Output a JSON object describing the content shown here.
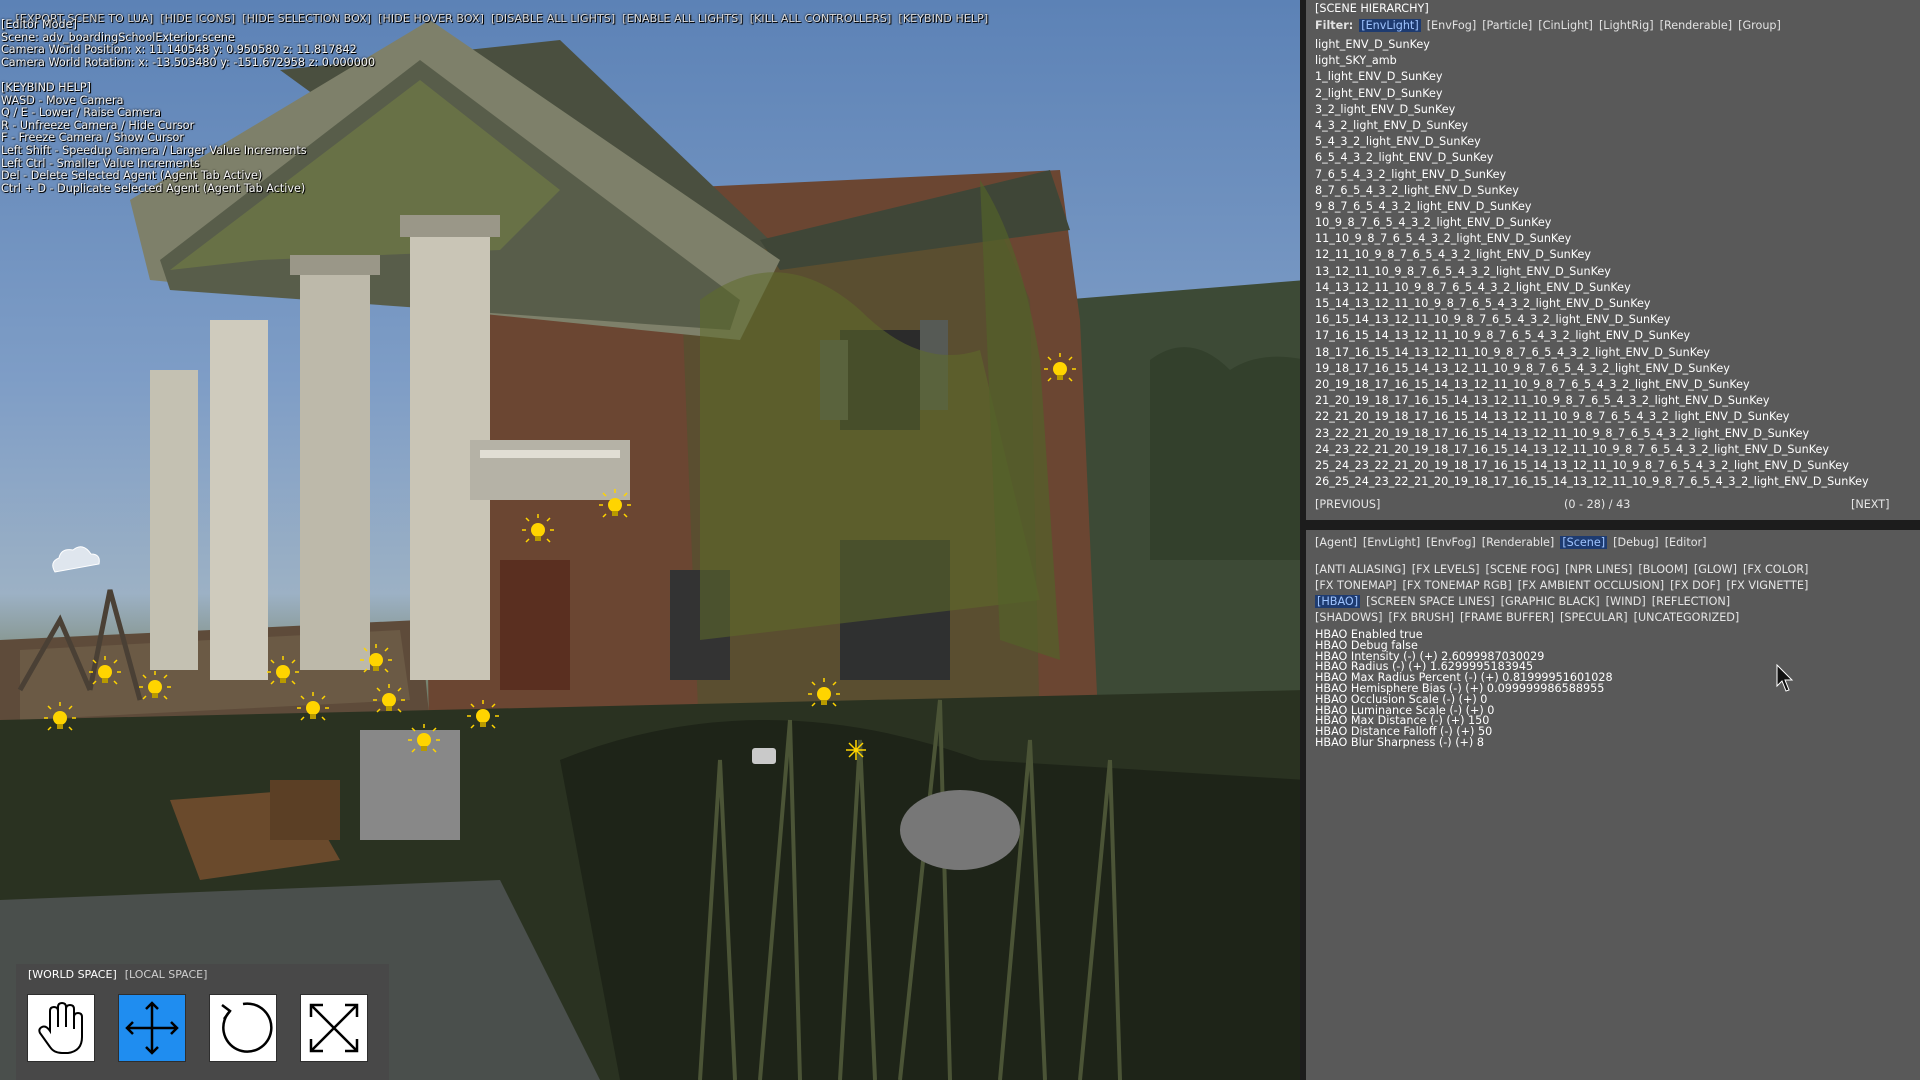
{
  "toolbar": {
    "items": [
      "[EXPORT SCENE TO LUA]",
      "[HIDE ICONS]",
      "[HIDE SELECTION BOX]",
      "[HIDE HOVER BOX]",
      "[DISABLE ALL LIGHTS]",
      "[ENABLE ALL LIGHTS]",
      "[KILL ALL CONTROLLERS]",
      "[KEYBIND HELP]"
    ]
  },
  "editor_info": {
    "mode": "[Editor Mode]",
    "scene": "Scene: adv_boardingSchoolExterior.scene",
    "camera_position": "Camera World Position: x: 11.140548 y: 0.950580 z: 11.817842",
    "camera_rotation": "Camera World Rotation: x: -13.503480 y: -151.672958 z: 0.000000"
  },
  "keybind_help": {
    "title": "[KEYBIND HELP]",
    "lines": [
      "WASD - Move Camera",
      "Q / E - Lower / Raise Camera",
      "R - Unfreeze Camera / Hide Cursor",
      "F - Freeze Camera / Show Cursor",
      "Left Shift - Speedup Camera / Larger Value Increments",
      "Left Ctrl - Smaller Value Increments",
      "Del - Delete Selected Agent (Agent Tab Active)",
      "Ctrl + D - Duplicate Selected Agent (Agent Tab Active)"
    ]
  },
  "gizmo": {
    "world_space": "[WORLD SPACE]",
    "local_space": "[LOCAL SPACE]",
    "tools": [
      "hand-icon",
      "move-icon",
      "rotate-icon",
      "scale-icon"
    ],
    "selected_color": "#1f8df0"
  },
  "hierarchy": {
    "title": "[SCENE HIERARCHY]",
    "filter_label": "Filter:",
    "filters": [
      "[EnvLight]",
      "[EnvFog]",
      "[Particle]",
      "[CinLight]",
      "[LightRig]",
      "[Renderable]",
      "[Group]"
    ],
    "active_filter": "[EnvLight]",
    "items": [
      "light_ENV_D_SunKey",
      "light_SKY_amb",
      "1_light_ENV_D_SunKey",
      "2_light_ENV_D_SunKey",
      "3_2_light_ENV_D_SunKey",
      "4_3_2_light_ENV_D_SunKey",
      "5_4_3_2_light_ENV_D_SunKey",
      "6_5_4_3_2_light_ENV_D_SunKey",
      "7_6_5_4_3_2_light_ENV_D_SunKey",
      "8_7_6_5_4_3_2_light_ENV_D_SunKey",
      "9_8_7_6_5_4_3_2_light_ENV_D_SunKey",
      "10_9_8_7_6_5_4_3_2_light_ENV_D_SunKey",
      "11_10_9_8_7_6_5_4_3_2_light_ENV_D_SunKey",
      "12_11_10_9_8_7_6_5_4_3_2_light_ENV_D_SunKey",
      "13_12_11_10_9_8_7_6_5_4_3_2_light_ENV_D_SunKey",
      "14_13_12_11_10_9_8_7_6_5_4_3_2_light_ENV_D_SunKey",
      "15_14_13_12_11_10_9_8_7_6_5_4_3_2_light_ENV_D_SunKey",
      "16_15_14_13_12_11_10_9_8_7_6_5_4_3_2_light_ENV_D_SunKey",
      "17_16_15_14_13_12_11_10_9_8_7_6_5_4_3_2_light_ENV_D_SunKey",
      "18_17_16_15_14_13_12_11_10_9_8_7_6_5_4_3_2_light_ENV_D_SunKey",
      "19_18_17_16_15_14_13_12_11_10_9_8_7_6_5_4_3_2_light_ENV_D_SunKey",
      "20_19_18_17_16_15_14_13_12_11_10_9_8_7_6_5_4_3_2_light_ENV_D_SunKey",
      "21_20_19_18_17_16_15_14_13_12_11_10_9_8_7_6_5_4_3_2_light_ENV_D_SunKey",
      "22_21_20_19_18_17_16_15_14_13_12_11_10_9_8_7_6_5_4_3_2_light_ENV_D_SunKey",
      "23_22_21_20_19_18_17_16_15_14_13_12_11_10_9_8_7_6_5_4_3_2_light_ENV_D_SunKey",
      "24_23_22_21_20_19_18_17_16_15_14_13_12_11_10_9_8_7_6_5_4_3_2_light_ENV_D_SunKey",
      "25_24_23_22_21_20_19_18_17_16_15_14_13_12_11_10_9_8_7_6_5_4_3_2_light_ENV_D_SunKey",
      "26_25_24_23_22_21_20_19_18_17_16_15_14_13_12_11_10_9_8_7_6_5_4_3_2_light_ENV_D_SunKey"
    ],
    "previous": "[PREVIOUS]",
    "page_info": "(0 - 28) / 43",
    "next": "[NEXT]"
  },
  "inspector": {
    "main_tabs": [
      "[Agent]",
      "[EnvLight]",
      "[EnvFog]",
      "[Renderable]",
      "[Scene]",
      "[Debug]",
      "[Editor]"
    ],
    "active_main_tab": "[Scene]",
    "category_rows": [
      [
        "[ANTI ALIASING]",
        "[FX LEVELS]",
        "[SCENE FOG]",
        "[NPR LINES]",
        "[BLOOM]",
        "[GLOW]",
        "[FX COLOR]"
      ],
      [
        "[FX TONEMAP]",
        "[FX TONEMAP RGB]",
        "[FX AMBIENT OCCLUSION]",
        "[FX DOF]",
        "[FX VIGNETTE]"
      ],
      [
        "[HBAO]",
        "[SCREEN SPACE LINES]",
        "[GRAPHIC BLACK]",
        "[WIND]",
        "[REFLECTION]"
      ],
      [
        "[SHADOWS]",
        "[FX BRUSH]",
        "[FRAME BUFFER]",
        "[SPECULAR]",
        "[UNCATEGORIZED]"
      ]
    ],
    "active_category": "[HBAO]",
    "properties": [
      "HBAO Enabled true",
      "HBAO Debug false",
      "HBAO Intensity (-) (+) 2.6099987030029",
      "HBAO Radius (-) (+) 1.6299995183945",
      "HBAO Max Radius Percent (-) (+) 0.81999951601028",
      "HBAO Hemisphere Bias (-) (+) 0.099999986588955",
      "HBAO Occlusion Scale (-) (+) 0",
      "HBAO Luminance Scale (-) (+) 0",
      "HBAO Max Distance (-) (+) 150",
      "HBAO Distance Falloff (-) (+) 50",
      "HBAO Blur Sharpness (-) (+) 8"
    ]
  },
  "colors": {
    "panel_bg": "#595959",
    "active_tab_bg": "#1e3b70",
    "light_icon": "#ffd400"
  }
}
